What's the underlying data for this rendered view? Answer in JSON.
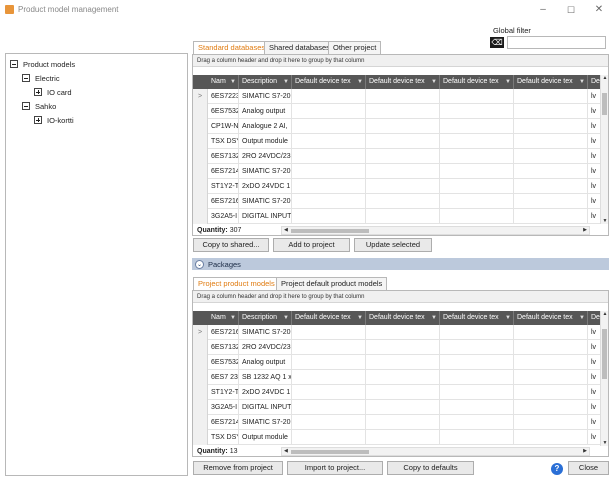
{
  "window": {
    "title": "Product model management",
    "minimize_glyph": "–",
    "maximize_glyph": "☐",
    "close_glyph": "✕"
  },
  "tree": {
    "root": "Product models",
    "nodes": [
      {
        "label": "Electric",
        "children": [
          {
            "label": "IO card"
          }
        ]
      },
      {
        "label": "Sahko",
        "children": [
          {
            "label": "IO-kortti"
          }
        ]
      }
    ]
  },
  "global_filter": {
    "label": "Global filter",
    "value": "",
    "button_icon": "clear-filter-icon"
  },
  "top_tabs": [
    "Standard databases",
    "Shared databases",
    "Other project"
  ],
  "group_hint": "Drag a column header and drop it here to group by that column",
  "columns": [
    "Nam",
    "Description",
    "Default device tex",
    "Default device tex",
    "Default device tex",
    "Default device tex",
    "De"
  ],
  "top_rows": [
    [
      "6ES7223",
      "SIMATIC S7-20",
      "",
      "",
      "",
      "",
      "lv"
    ],
    [
      "6ES7532",
      "Analog output",
      "",
      "",
      "",
      "",
      "lv"
    ],
    [
      "CP1W-N",
      "Analogue 2 AI,",
      "",
      "",
      "",
      "",
      "lv"
    ],
    [
      "TSX DSY",
      "Output module",
      "",
      "",
      "",
      "",
      "lv"
    ],
    [
      "6ES7132",
      "2RO 24VDC/23",
      "",
      "",
      "",
      "",
      "lv"
    ],
    [
      "6ES7214",
      "SIMATIC S7-20",
      "",
      "",
      "",
      "",
      "lv"
    ],
    [
      "ST1Y2-T",
      "2xDO 24VDC 1",
      "",
      "",
      "",
      "",
      "lv"
    ],
    [
      "6ES7216",
      "SIMATIC S7-20",
      "",
      "",
      "",
      "",
      "lv"
    ],
    [
      "3G2A5-I",
      "DIGITAL INPUT",
      "",
      "",
      "",
      "",
      "lv"
    ]
  ],
  "top_quantity_label": "Quantity:",
  "top_quantity": "307",
  "top_buttons": [
    "Copy to shared...",
    "Add to project",
    "Update selected"
  ],
  "packages_label": "Packages",
  "bottom_tabs": [
    "Project product models",
    "Project default product models"
  ],
  "bottom_rows": [
    [
      "6ES7216",
      "SIMATIC S7-20",
      "",
      "",
      "",
      "",
      "lv"
    ],
    [
      "6ES7132",
      "2RO 24VDC/23",
      "",
      "",
      "",
      "",
      "lv"
    ],
    [
      "6ES7532",
      "Analog output",
      "",
      "",
      "",
      "",
      "lv"
    ],
    [
      "6ES7 23",
      "SB 1232 AQ 1 x",
      "",
      "",
      "",
      "",
      "lv"
    ],
    [
      "ST1Y2-T",
      "2xDO 24VDC 1",
      "",
      "",
      "",
      "",
      "lv"
    ],
    [
      "3G2A5-I",
      "DIGITAL INPUT",
      "",
      "",
      "",
      "",
      "lv"
    ],
    [
      "6ES7214",
      "SIMATIC S7-20",
      "",
      "",
      "",
      "",
      "lv"
    ],
    [
      "TSX DSY",
      "Output module",
      "",
      "",
      "",
      "",
      "lv"
    ]
  ],
  "bottom_quantity_label": "Quantity:",
  "bottom_quantity": "13",
  "bottom_buttons": [
    "Remove from project",
    "Import to project...",
    "Copy to defaults"
  ],
  "help_glyph": "?",
  "close_button": "Close",
  "colors": {
    "accent": "#e07b10",
    "header": "#575757",
    "packages_bar": "#bcc9dc"
  }
}
